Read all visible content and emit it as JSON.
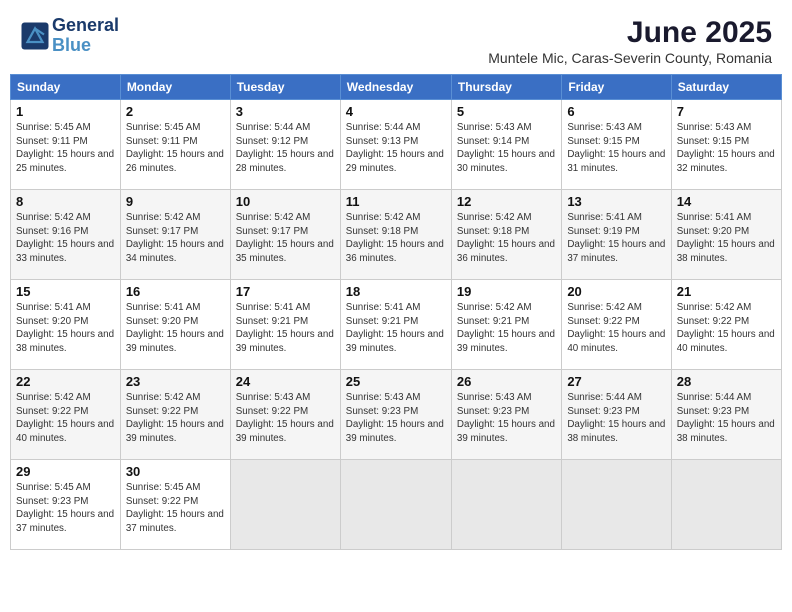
{
  "header": {
    "logo_line1": "General",
    "logo_line2": "Blue",
    "month": "June 2025",
    "location": "Muntele Mic, Caras-Severin County, Romania"
  },
  "days_of_week": [
    "Sunday",
    "Monday",
    "Tuesday",
    "Wednesday",
    "Thursday",
    "Friday",
    "Saturday"
  ],
  "weeks": [
    [
      {
        "day": "1",
        "sunrise": "5:45 AM",
        "sunset": "9:11 PM",
        "daylight": "15 hours and 25 minutes."
      },
      {
        "day": "2",
        "sunrise": "5:45 AM",
        "sunset": "9:11 PM",
        "daylight": "15 hours and 26 minutes."
      },
      {
        "day": "3",
        "sunrise": "5:44 AM",
        "sunset": "9:12 PM",
        "daylight": "15 hours and 28 minutes."
      },
      {
        "day": "4",
        "sunrise": "5:44 AM",
        "sunset": "9:13 PM",
        "daylight": "15 hours and 29 minutes."
      },
      {
        "day": "5",
        "sunrise": "5:43 AM",
        "sunset": "9:14 PM",
        "daylight": "15 hours and 30 minutes."
      },
      {
        "day": "6",
        "sunrise": "5:43 AM",
        "sunset": "9:15 PM",
        "daylight": "15 hours and 31 minutes."
      },
      {
        "day": "7",
        "sunrise": "5:43 AM",
        "sunset": "9:15 PM",
        "daylight": "15 hours and 32 minutes."
      }
    ],
    [
      {
        "day": "8",
        "sunrise": "5:42 AM",
        "sunset": "9:16 PM",
        "daylight": "15 hours and 33 minutes."
      },
      {
        "day": "9",
        "sunrise": "5:42 AM",
        "sunset": "9:17 PM",
        "daylight": "15 hours and 34 minutes."
      },
      {
        "day": "10",
        "sunrise": "5:42 AM",
        "sunset": "9:17 PM",
        "daylight": "15 hours and 35 minutes."
      },
      {
        "day": "11",
        "sunrise": "5:42 AM",
        "sunset": "9:18 PM",
        "daylight": "15 hours and 36 minutes."
      },
      {
        "day": "12",
        "sunrise": "5:42 AM",
        "sunset": "9:18 PM",
        "daylight": "15 hours and 36 minutes."
      },
      {
        "day": "13",
        "sunrise": "5:41 AM",
        "sunset": "9:19 PM",
        "daylight": "15 hours and 37 minutes."
      },
      {
        "day": "14",
        "sunrise": "5:41 AM",
        "sunset": "9:20 PM",
        "daylight": "15 hours and 38 minutes."
      }
    ],
    [
      {
        "day": "15",
        "sunrise": "5:41 AM",
        "sunset": "9:20 PM",
        "daylight": "15 hours and 38 minutes."
      },
      {
        "day": "16",
        "sunrise": "5:41 AM",
        "sunset": "9:20 PM",
        "daylight": "15 hours and 39 minutes."
      },
      {
        "day": "17",
        "sunrise": "5:41 AM",
        "sunset": "9:21 PM",
        "daylight": "15 hours and 39 minutes."
      },
      {
        "day": "18",
        "sunrise": "5:41 AM",
        "sunset": "9:21 PM",
        "daylight": "15 hours and 39 minutes."
      },
      {
        "day": "19",
        "sunrise": "5:42 AM",
        "sunset": "9:21 PM",
        "daylight": "15 hours and 39 minutes."
      },
      {
        "day": "20",
        "sunrise": "5:42 AM",
        "sunset": "9:22 PM",
        "daylight": "15 hours and 40 minutes."
      },
      {
        "day": "21",
        "sunrise": "5:42 AM",
        "sunset": "9:22 PM",
        "daylight": "15 hours and 40 minutes."
      }
    ],
    [
      {
        "day": "22",
        "sunrise": "5:42 AM",
        "sunset": "9:22 PM",
        "daylight": "15 hours and 40 minutes."
      },
      {
        "day": "23",
        "sunrise": "5:42 AM",
        "sunset": "9:22 PM",
        "daylight": "15 hours and 39 minutes."
      },
      {
        "day": "24",
        "sunrise": "5:43 AM",
        "sunset": "9:22 PM",
        "daylight": "15 hours and 39 minutes."
      },
      {
        "day": "25",
        "sunrise": "5:43 AM",
        "sunset": "9:23 PM",
        "daylight": "15 hours and 39 minutes."
      },
      {
        "day": "26",
        "sunrise": "5:43 AM",
        "sunset": "9:23 PM",
        "daylight": "15 hours and 39 minutes."
      },
      {
        "day": "27",
        "sunrise": "5:44 AM",
        "sunset": "9:23 PM",
        "daylight": "15 hours and 38 minutes."
      },
      {
        "day": "28",
        "sunrise": "5:44 AM",
        "sunset": "9:23 PM",
        "daylight": "15 hours and 38 minutes."
      }
    ],
    [
      {
        "day": "29",
        "sunrise": "5:45 AM",
        "sunset": "9:23 PM",
        "daylight": "15 hours and 37 minutes."
      },
      {
        "day": "30",
        "sunrise": "5:45 AM",
        "sunset": "9:22 PM",
        "daylight": "15 hours and 37 minutes."
      },
      null,
      null,
      null,
      null,
      null
    ]
  ]
}
